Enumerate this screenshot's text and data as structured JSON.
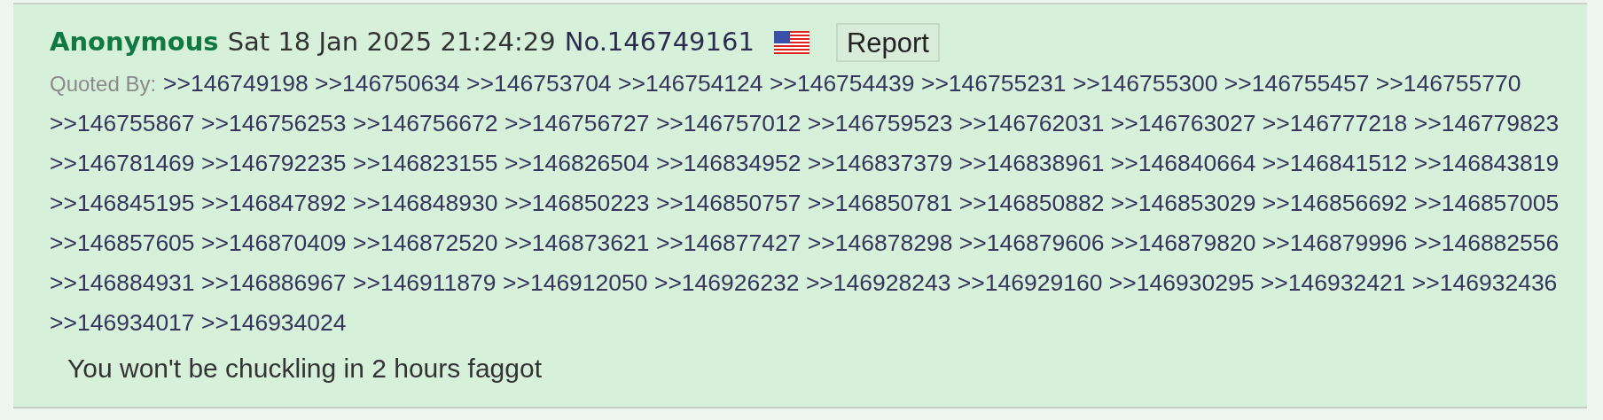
{
  "post": {
    "name": "Anonymous",
    "datetime": "Sat 18 Jan 2025 21:24:29",
    "number": "No.146749161",
    "report_button": "Report",
    "quoted_by_label": "Quoted By:",
    "quoted_by": [
      ">>146749198",
      ">>146750634",
      ">>146753704",
      ">>146754124",
      ">>146754439",
      ">>146755231",
      ">>146755300",
      ">>146755457",
      ">>146755770",
      ">>146755867",
      ">>146756253",
      ">>146756672",
      ">>146756727",
      ">>146757012",
      ">>146759523",
      ">>146762031",
      ">>146763027",
      ">>146777218",
      ">>146779823",
      ">>146781469",
      ">>146792235",
      ">>146823155",
      ">>146826504",
      ">>146834952",
      ">>146837379",
      ">>146838961",
      ">>146840664",
      ">>146841512",
      ">>146843819",
      ">>146845195",
      ">>146847892",
      ">>146848930",
      ">>146850223",
      ">>146850757",
      ">>146850781",
      ">>146850882",
      ">>146853029",
      ">>146856692",
      ">>146857005",
      ">>146857605",
      ">>146870409",
      ">>146872520",
      ">>146873621",
      ">>146877427",
      ">>146878298",
      ">>146879606",
      ">>146879820",
      ">>146879996",
      ">>146882556",
      ">>146884931",
      ">>146886967",
      ">>146911879",
      ">>146912050",
      ">>146926232",
      ">>146928243",
      ">>146929160",
      ">>146930295",
      ">>146932421",
      ">>146932436",
      ">>146934017",
      ">>146934024"
    ],
    "message": "You won't be chuckling in 2 hours faggot"
  }
}
